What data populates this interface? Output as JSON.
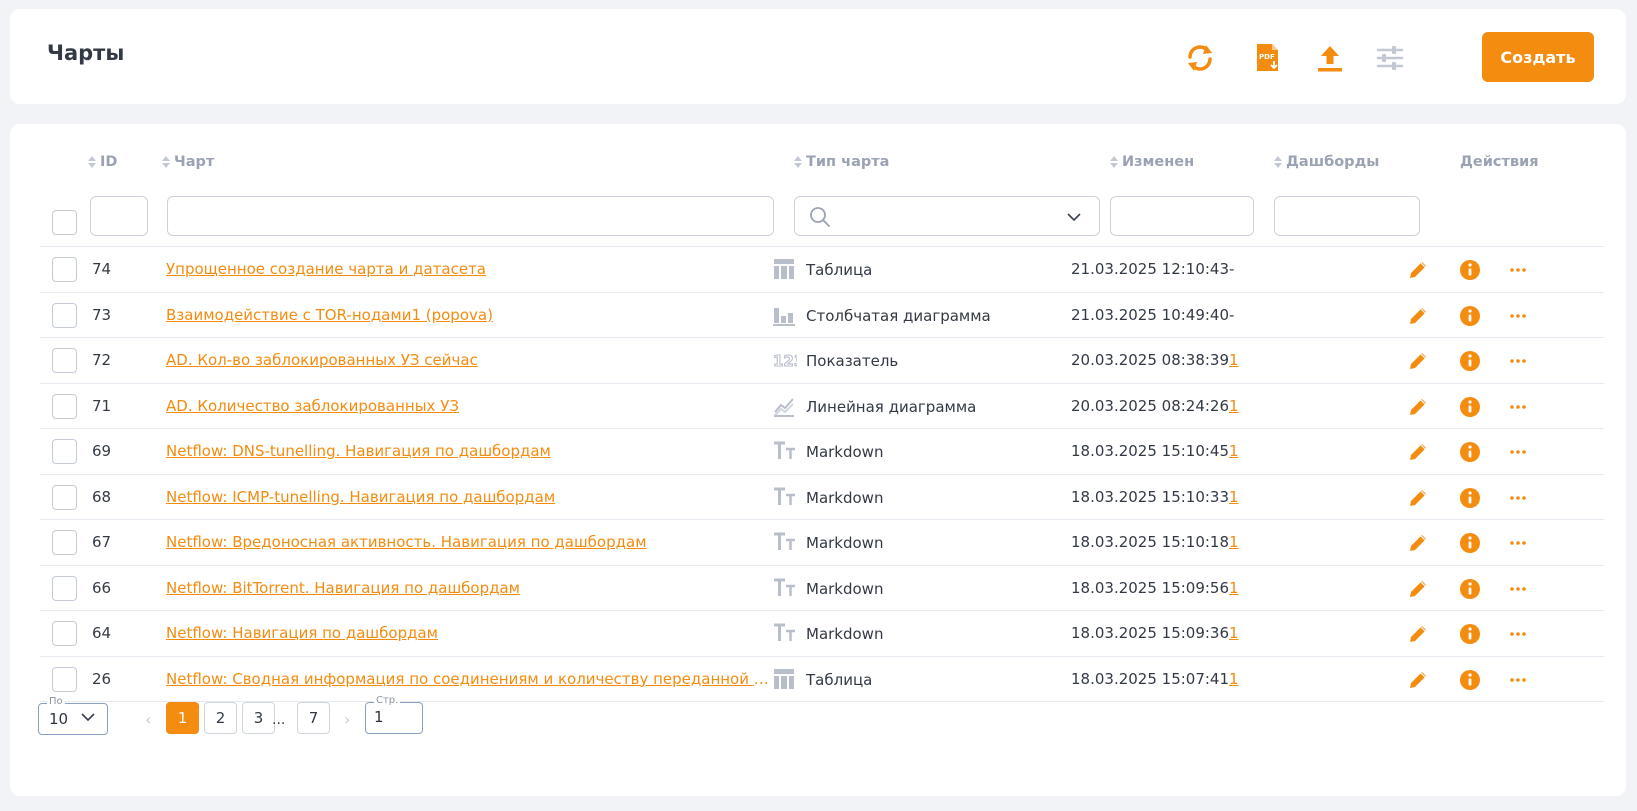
{
  "page": {
    "title": "Чарты",
    "create_label": "Создать"
  },
  "toolbar": {
    "icons": [
      "refresh-icon",
      "pdf-download-icon",
      "upload-icon",
      "filter-settings-icon"
    ]
  },
  "colors": {
    "accent": "#f48c10",
    "header_text": "#9aa2b3",
    "body_text": "#333a46",
    "icon_gray": "#b9bfca"
  },
  "table": {
    "columns": {
      "id": "ID",
      "chart": "Чарт",
      "type": "Тип чарта",
      "modified": "Изменен",
      "dashboards": "Дашборды",
      "actions": "Действия"
    },
    "rows": [
      {
        "id": "74",
        "name": "Упрощенное создание чарта и датасета",
        "type": "Таблица",
        "type_icon": "table-icon",
        "modified": "21.03.2025 12:10:43",
        "dashboards": "-"
      },
      {
        "id": "73",
        "name": "Взаимодействие с TOR-нодами1 (popova)",
        "type": "Столбчатая диаграмма",
        "type_icon": "bar-chart-icon",
        "modified": "21.03.2025 10:49:40",
        "dashboards": "-"
      },
      {
        "id": "72",
        "name": "AD. Кол-во заблокированных УЗ сейчас",
        "type": "Показатель",
        "type_icon": "number-indicator-icon",
        "modified": "20.03.2025 08:38:39",
        "dashboards": "1"
      },
      {
        "id": "71",
        "name": "AD. Количество заблокированных УЗ",
        "type": "Линейная диаграмма",
        "type_icon": "line-chart-icon",
        "modified": "20.03.2025 08:24:26",
        "dashboards": "1"
      },
      {
        "id": "69",
        "name": "Netflow: DNS-tunelling. Навигация по дашбордам",
        "type": "Markdown",
        "type_icon": "text-icon",
        "modified": "18.03.2025 15:10:45",
        "dashboards": "1"
      },
      {
        "id": "68",
        "name": "Netflow: ICMP-tunelling. Навигация по дашбордам",
        "type": "Markdown",
        "type_icon": "text-icon",
        "modified": "18.03.2025 15:10:33",
        "dashboards": "1"
      },
      {
        "id": "67",
        "name": "Netflow: Вредоносная активность. Навигация по дашбордам",
        "type": "Markdown",
        "type_icon": "text-icon",
        "modified": "18.03.2025 15:10:18",
        "dashboards": "1"
      },
      {
        "id": "66",
        "name": "Netflow: BitTorrent. Навигация по дашбордам",
        "type": "Markdown",
        "type_icon": "text-icon",
        "modified": "18.03.2025 15:09:56",
        "dashboards": "1"
      },
      {
        "id": "64",
        "name": "Netflow: Навигация по дашбордам",
        "type": "Markdown",
        "type_icon": "text-icon",
        "modified": "18.03.2025 15:09:36",
        "dashboards": "1"
      },
      {
        "id": "26",
        "name": "Netflow: Сводная информация по соединениям и количеству переданной информации",
        "type": "Таблица",
        "type_icon": "table-icon",
        "modified": "18.03.2025 15:07:41",
        "dashboards": "1"
      }
    ]
  },
  "pagination": {
    "per_page_label": "По",
    "per_page_value": "10",
    "pages": [
      "1",
      "2",
      "3",
      "7"
    ],
    "current_page": "1",
    "ellipsis": "...",
    "prev": "‹",
    "next": "›",
    "goto_label": "Стр.",
    "goto_value": "1"
  }
}
